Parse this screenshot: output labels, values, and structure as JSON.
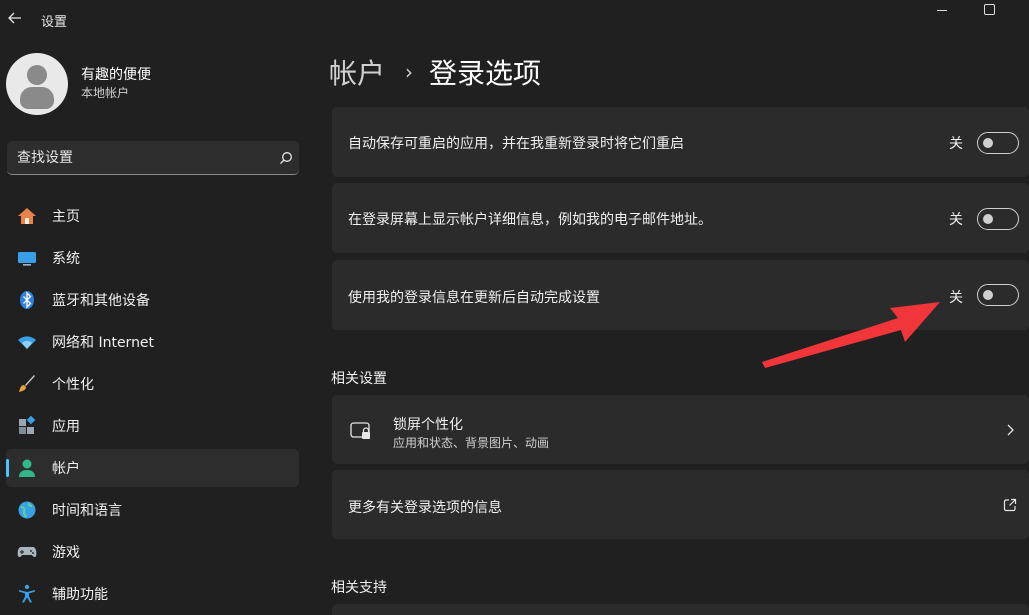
{
  "window": {
    "title": "设置"
  },
  "profile": {
    "name": "有趣的便便",
    "type": "本地帐户"
  },
  "search": {
    "placeholder": "查找设置"
  },
  "nav": {
    "items": [
      {
        "label": "主页",
        "icon": "home-icon"
      },
      {
        "label": "系统",
        "icon": "system-icon"
      },
      {
        "label": "蓝牙和其他设备",
        "icon": "bluetooth-icon"
      },
      {
        "label": "网络和 Internet",
        "icon": "wifi-icon"
      },
      {
        "label": "个性化",
        "icon": "brush-icon"
      },
      {
        "label": "应用",
        "icon": "apps-icon"
      },
      {
        "label": "帐户",
        "icon": "account-icon",
        "active": true
      },
      {
        "label": "时间和语言",
        "icon": "globe-icon"
      },
      {
        "label": "游戏",
        "icon": "gamepad-icon"
      },
      {
        "label": "辅助功能",
        "icon": "accessibility-icon"
      }
    ]
  },
  "breadcrumb": {
    "parent": "帐户",
    "separator": "›",
    "current": "登录选项"
  },
  "settings": [
    {
      "label": "自动保存可重启的应用，并在我重新登录时将它们重启",
      "state": "关",
      "on": false
    },
    {
      "label": "在登录屏幕上显示帐户详细信息，例如我的电子邮件地址。",
      "state": "关",
      "on": false
    },
    {
      "label": "使用我的登录信息在更新后自动完成设置",
      "state": "关",
      "on": false
    }
  ],
  "related_settings": {
    "title": "相关设置",
    "lock_screen": {
      "title": "锁屏个性化",
      "subtitle": "应用和状态、背景图片、动画"
    },
    "more_info": {
      "label": "更多有关登录选项的信息"
    }
  },
  "related_support": {
    "title": "相关支持"
  },
  "colors": {
    "accent": "#4cc2ff",
    "arrow": "#f0363a",
    "background": "#202020",
    "card": "#2b2b2b"
  }
}
